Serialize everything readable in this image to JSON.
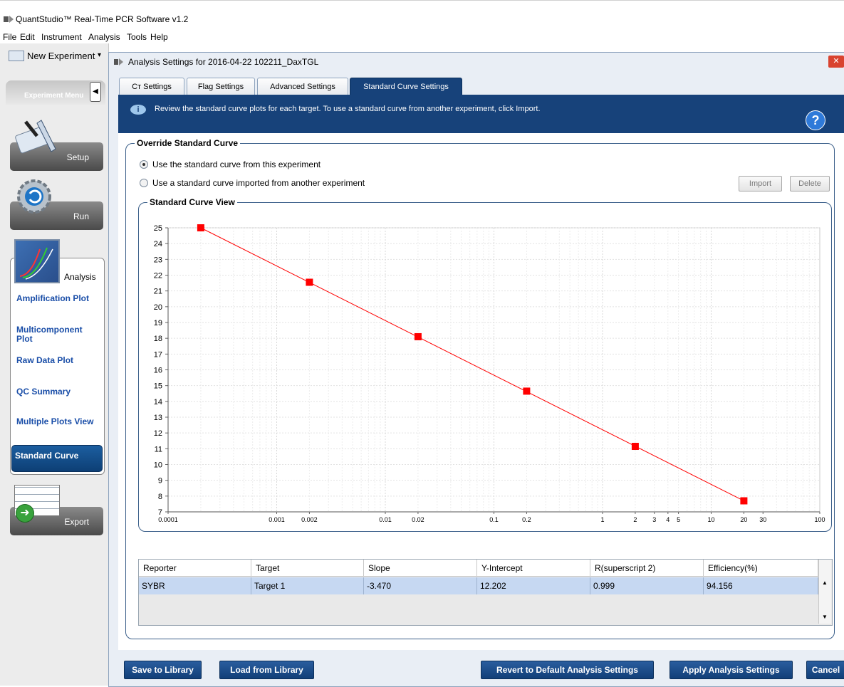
{
  "app": {
    "title": "QuantStudio™ Real-Time PCR Software v1.2",
    "menu": [
      "File",
      "Edit",
      "Instrument",
      "Analysis",
      "Tools",
      "Help"
    ]
  },
  "leftnav": {
    "new_experiment": "New Experiment",
    "experiment_menu": "Experiment Menu",
    "setup": "Setup",
    "run": "Run",
    "analysis": "Analysis",
    "export": "Export",
    "analysis_items": [
      "Amplification Plot",
      "Multicomponent Plot",
      "Raw Data Plot",
      "QC Summary",
      "Multiple Plots View"
    ],
    "active_item": "Standard Curve"
  },
  "dialog": {
    "title": "Analysis Settings for 2016-04-22 102211_DaxTGL",
    "tabs": [
      "Cт Settings",
      "Flag Settings",
      "Advanced Settings",
      "Standard Curve Settings"
    ],
    "active_tab": 3,
    "banner_text": "Review the standard curve plots for each target. To use a standard curve from another experiment, click Import.",
    "override_title": "Override Standard Curve",
    "radio_this": "Use the standard curve from this experiment",
    "radio_imported": "Use a standard curve imported from another experiment",
    "selected_radio": "this",
    "import_btn": "Import",
    "delete_btn": "Delete",
    "view_title": "Standard Curve View"
  },
  "chart_data": {
    "type": "scatter",
    "x_scale": "log",
    "xlim": [
      0.0001,
      100
    ],
    "ylim": [
      7,
      25
    ],
    "x_tick_labels": [
      "0.0001",
      "0.001",
      "0.002",
      "0.01",
      "0.02",
      "0.1",
      "0.2",
      "1",
      "2",
      "3",
      "4",
      "5",
      "10",
      "20",
      "30",
      "100"
    ],
    "x_tick_values": [
      0.0001,
      0.001,
      0.002,
      0.01,
      0.02,
      0.1,
      0.2,
      1,
      2,
      3,
      4,
      5,
      10,
      20,
      30,
      100
    ],
    "y_ticks": [
      7,
      8,
      9,
      10,
      11,
      12,
      13,
      14,
      15,
      16,
      17,
      18,
      19,
      20,
      21,
      22,
      23,
      24,
      25
    ],
    "grid": true,
    "points": [
      {
        "x": 0.0002,
        "y": 25.0
      },
      {
        "x": 0.002,
        "y": 21.55
      },
      {
        "x": 0.02,
        "y": 18.1
      },
      {
        "x": 0.2,
        "y": 14.65
      },
      {
        "x": 2,
        "y": 11.15
      },
      {
        "x": 20,
        "y": 7.7
      }
    ],
    "fit_line": {
      "slope": -3.47,
      "intercept": 12.202
    },
    "color": "#ff0000"
  },
  "table": {
    "columns": [
      "Reporter",
      "Target",
      "Slope",
      "Y-Intercept",
      "R(superscript 2)",
      "Efficiency(%)"
    ],
    "rows": [
      [
        "SYBR",
        "Target 1",
        "-3.470",
        "12.202",
        "0.999",
        "94.156"
      ]
    ]
  },
  "buttons": {
    "save": "Save to Library",
    "load": "Load from Library",
    "revert": "Revert to Default Analysis Settings",
    "apply": "Apply Analysis Settings",
    "cancel": "Cancel"
  }
}
